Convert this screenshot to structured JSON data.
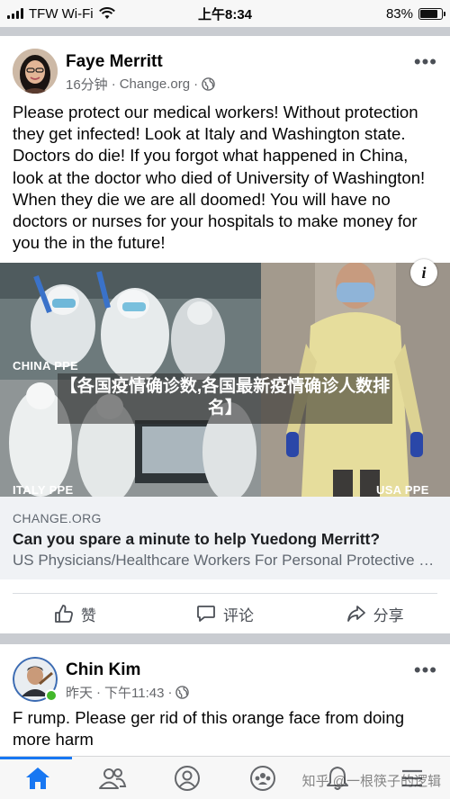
{
  "status_bar": {
    "carrier": "TFW Wi-Fi",
    "time": "上午8:34",
    "battery_percent": "83%",
    "battery_level": 0.83
  },
  "post1": {
    "author": "Faye Merritt",
    "time_ago": "16分钟",
    "source": "Change.org",
    "audience_icon": "globe-icon",
    "text": "Please protect our medical workers! Without protection they get infected! Look at Italy and Washington state. Doctors do die! If you forgot what happened in China, look at the doctor who died of University of Washington! When they die we are all doomed! You will have no doctors or nurses for your hospitals to make money for you the in the future!",
    "image": {
      "label_top_left": "CHINA PPE",
      "label_bottom_left": "ITALY PPE",
      "label_bottom_right": "USA PPE",
      "overlay_title": "【各国疫情确诊数,各国最新疫情确诊人数排名】"
    },
    "link": {
      "domain": "CHANGE.ORG",
      "headline": "Can you spare a minute to help Yuedong Merritt?",
      "description": "US Physicians/Healthcare Workers For Personal Protective Equipment"
    },
    "actions": {
      "like": "赞",
      "comment": "评论",
      "share": "分享"
    }
  },
  "post2": {
    "author": "Chin Kim",
    "date": "昨天",
    "time": "下午11:43",
    "audience_icon": "globe-icon",
    "text": "F rump. Please ger rid of this orange face from doing more harm"
  },
  "tab_bar": {
    "tabs": [
      "home-icon",
      "friends-icon",
      "profile-icon",
      "groups-icon",
      "notifications-icon",
      "menu-icon"
    ],
    "active_tab": "home-icon",
    "watermark": "知乎 @一根筷子的逻辑"
  },
  "colors": {
    "accent": "#1877f2",
    "online": "#42b72a",
    "secondary_text": "#65676b"
  }
}
